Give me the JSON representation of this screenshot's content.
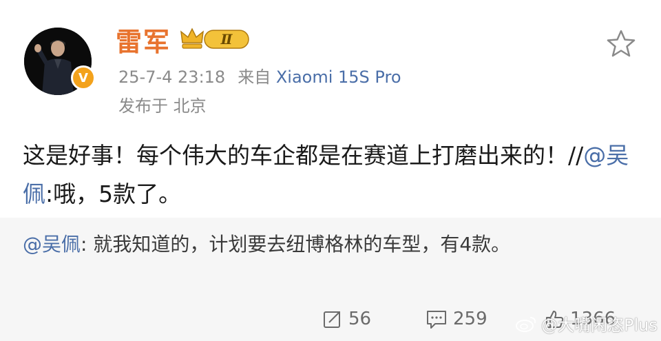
{
  "post": {
    "username": "雷军",
    "rank_badge": "Ⅱ",
    "verified_badge": "V",
    "timestamp": "25-7-4 23:18",
    "source_prefix": "来自",
    "source_device": "Xiaomi 15S Pro",
    "location": "发布于 北京",
    "content_main": "这是好事！每个伟大的车企都是在赛道上打磨出来的！//",
    "content_mention": "@吴佩",
    "content_tail": ":哦，5款了。"
  },
  "repost": {
    "mention": "@吴佩",
    "text": ": 就我知道的，计划要去纽博格林的车型，有4款。"
  },
  "actions": {
    "repost_count": "56",
    "comment_count": "259",
    "like_count": "1366"
  },
  "watermark": {
    "text": "@大嘴闲恣Plus"
  },
  "colors": {
    "username": "#e8732e",
    "link": "#4a6ea8",
    "meta": "#8a8a8a",
    "repost_bg": "#f6f6f6",
    "vip_badge": "#f3a21c"
  }
}
